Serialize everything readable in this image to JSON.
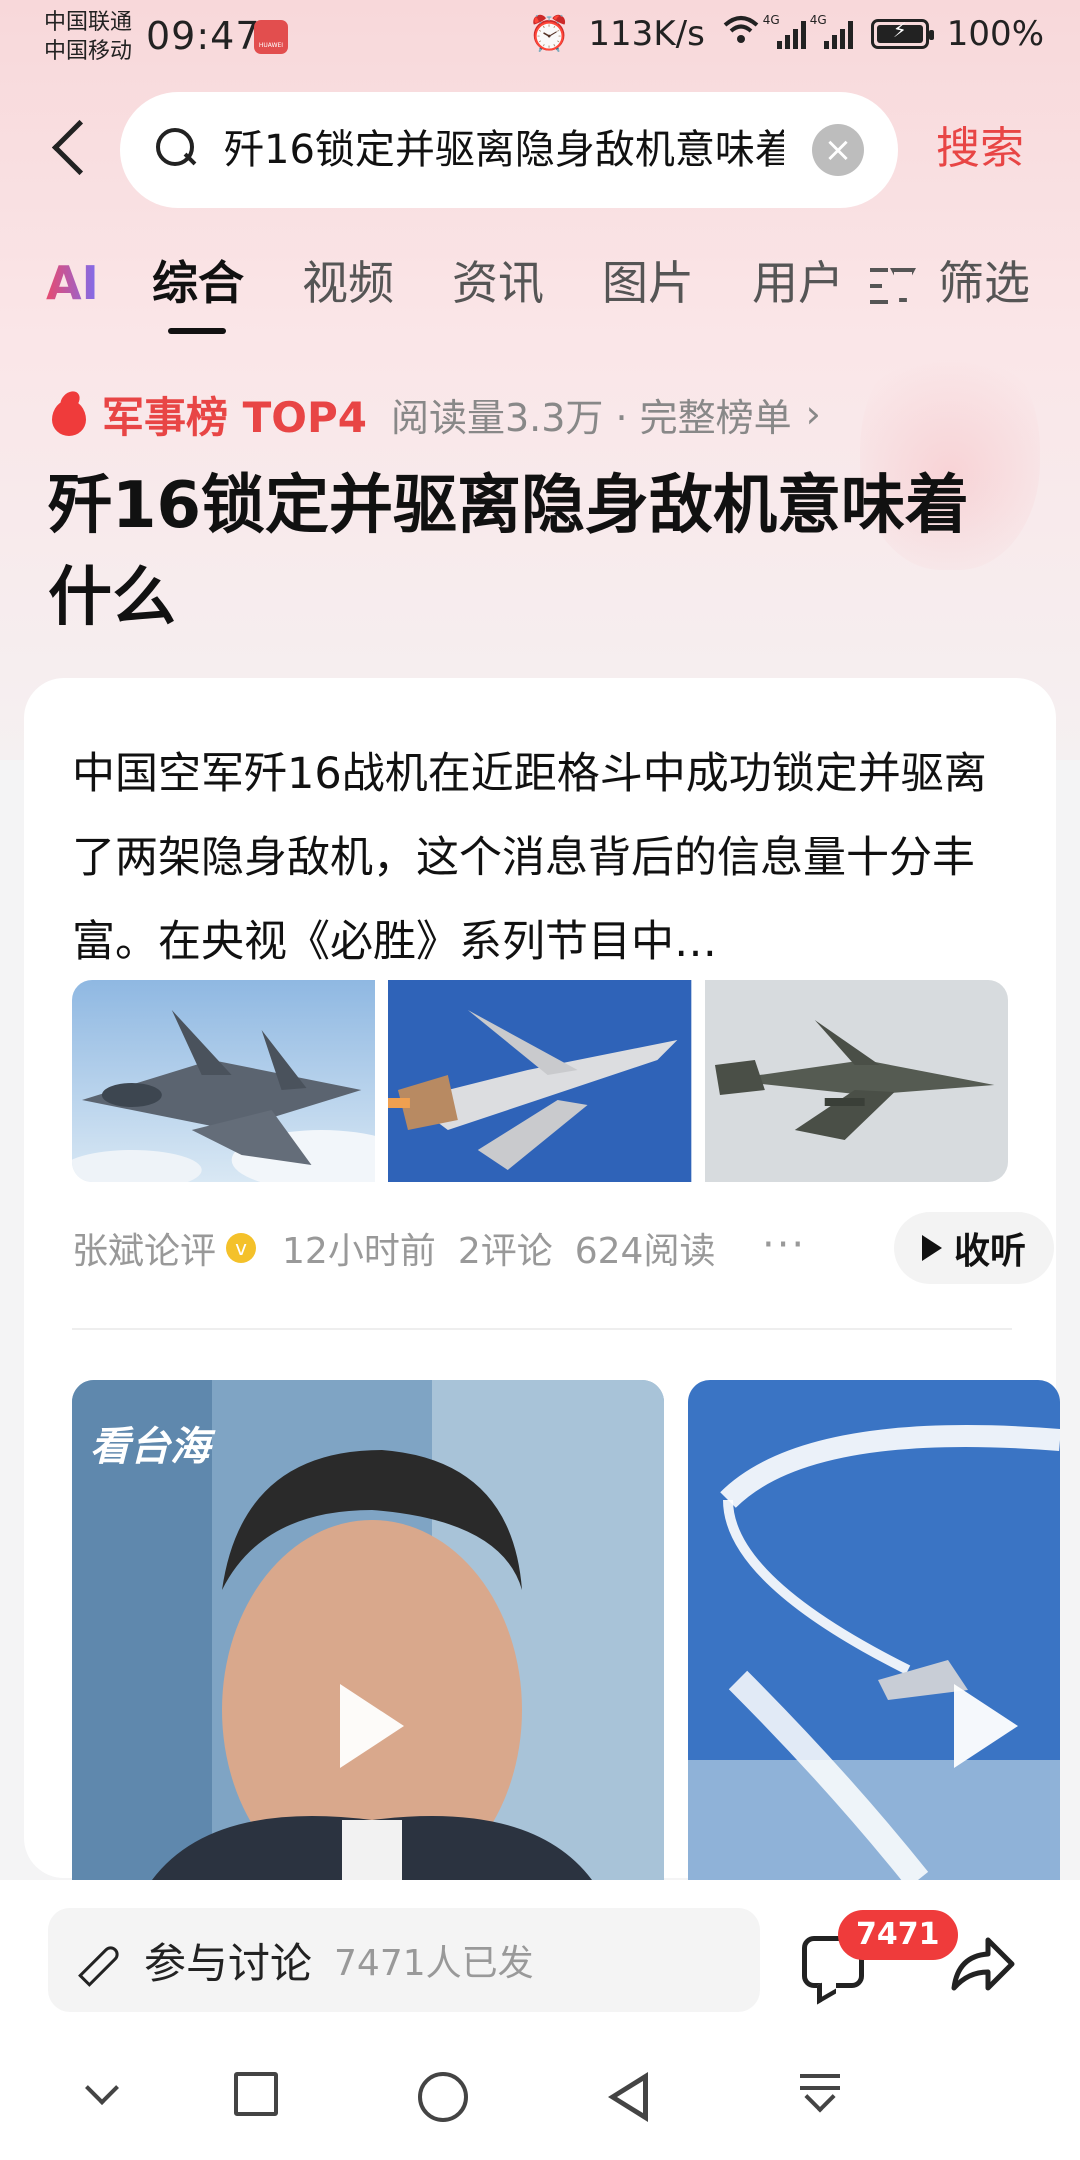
{
  "status_bar": {
    "carrier_1": "中国联通",
    "carrier_2": "中国移动",
    "time": "09:47",
    "badge": "HUAWEI",
    "net_speed": "113K/s",
    "net_tag_1": "4G",
    "net_tag_2": "4G",
    "battery": "100%",
    "battery_level": 1.0
  },
  "search": {
    "query": "歼16锁定并驱离隐身敌机意味着什么",
    "submit_label": "搜索"
  },
  "tabs": {
    "ai": "AI",
    "items": [
      "综合",
      "视频",
      "资讯",
      "图片",
      "用户"
    ],
    "active_index": 0,
    "filter": "筛选"
  },
  "rank": {
    "title": "军事榜 TOP4",
    "meta": "阅读量3.3万 · 完整榜单",
    "chevron": "›"
  },
  "headline": "歼16锁定并驱离隐身敌机意味着什么",
  "article": {
    "summary": "中国空军歼16战机在近距格斗中成功锁定并驱离了两架隐身敌机，这个消息背后的信息量十分丰富。在央视《必胜》系列节目中…",
    "author": "张斌论评",
    "verified": "v",
    "time": "12小时前",
    "comments": "2评论",
    "reads": "624阅读",
    "more": "···",
    "listen_label": "收听"
  },
  "videos": {
    "watermark": "看台海"
  },
  "bottom_bar": {
    "discuss_label": "参与讨论",
    "discuss_count": "7471人已发",
    "comment_badge": "7471"
  },
  "colors": {
    "accent": "#e84545",
    "badge": "#ef3b3b"
  }
}
